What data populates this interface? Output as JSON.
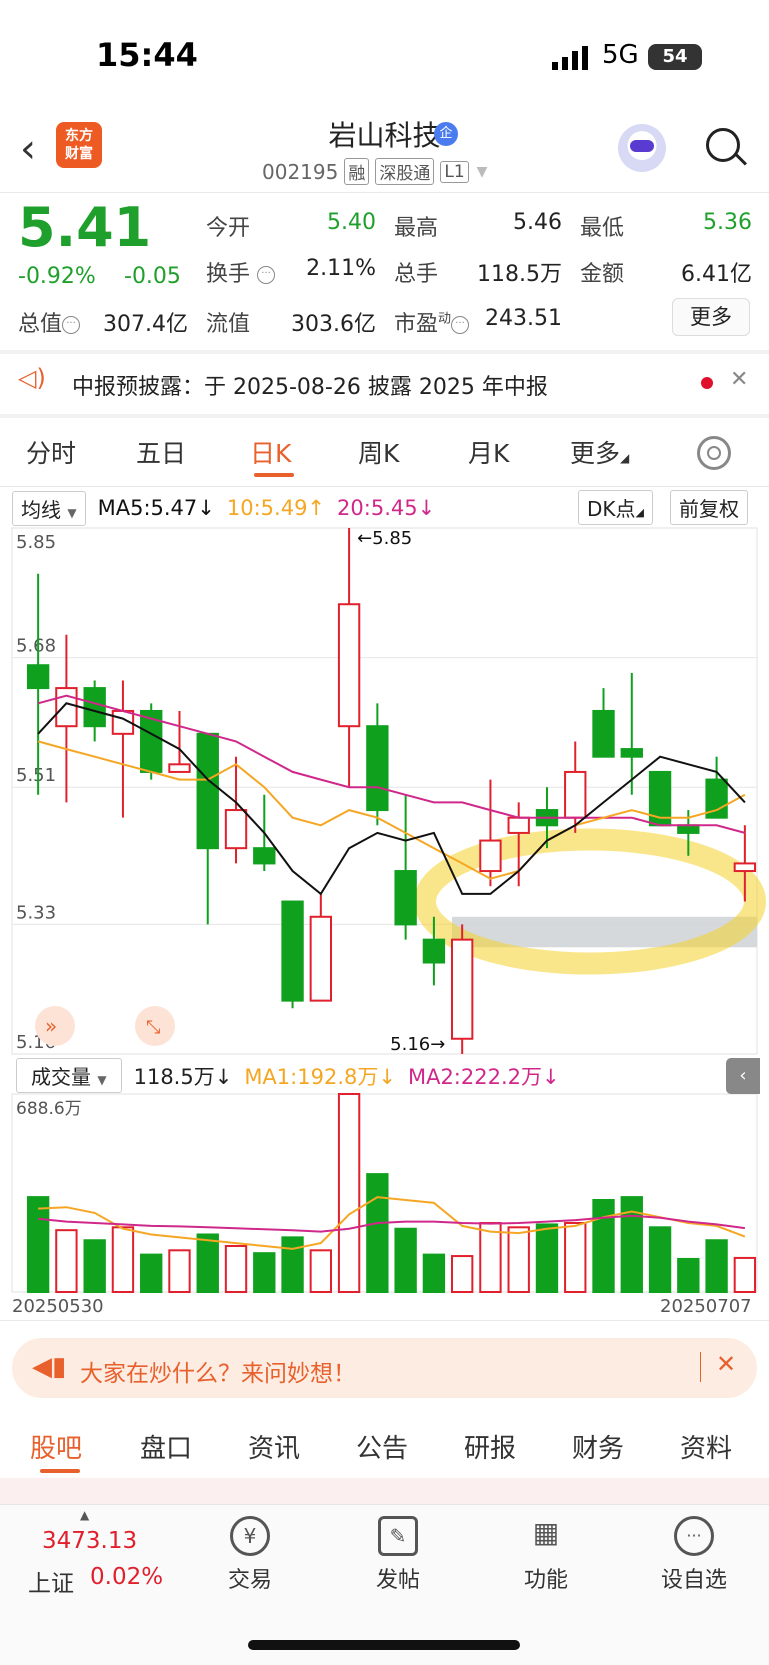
{
  "status": {
    "time": "15:44",
    "network": "5G",
    "battery": "54"
  },
  "header": {
    "app_logo": "东方\n财富",
    "stock_name": "岩山科技",
    "qi_badge": "企",
    "code": "002195",
    "tags": [
      "融",
      "深股通",
      "L1"
    ]
  },
  "quote": {
    "price": "5.41",
    "change_pct": "-0.92%",
    "change_abs": "-0.05",
    "fields": [
      {
        "label": "今开",
        "value": "5.40"
      },
      {
        "label": "最高",
        "value": "5.46"
      },
      {
        "label": "最低",
        "value": "5.36"
      },
      {
        "label": "换手",
        "value": "2.11%"
      },
      {
        "label": "总手",
        "value": "118.5万"
      },
      {
        "label": "金额",
        "value": "6.41亿"
      },
      {
        "label": "总值",
        "value": "307.4亿"
      },
      {
        "label": "流值",
        "value": "303.6亿"
      },
      {
        "label": "市盈",
        "label_sup": "动",
        "value": "243.51"
      }
    ],
    "more_button": "更多"
  },
  "notice": {
    "text": "中报预披露：于 2025-08-26 披露 2025 年中报"
  },
  "tabs": [
    "分时",
    "五日",
    "日K",
    "周K",
    "月K",
    "更多"
  ],
  "active_tab": "日K",
  "ma_bar": {
    "selector": "均线",
    "ma5": "MA5:5.47↓",
    "ma10": "10:5.49↑",
    "ma20": "20:5.45↓",
    "dk_button": "DK点",
    "fq_button": "前复权"
  },
  "volume_bar": {
    "selector": "成交量",
    "current": "118.5万↓",
    "ma1": "MA1:192.8万↓",
    "ma2": "MA2:222.2万↓"
  },
  "colors": {
    "up": "#e0202c",
    "down": "#0fa01e",
    "ma5": "#111111",
    "ma10": "#f5a623",
    "ma20": "#d0288a",
    "accent": "#e8602c"
  },
  "chart_data": {
    "type": "candlestick",
    "y_ticks": [
      "5.85",
      "5.68",
      "5.51",
      "5.33",
      "5.16"
    ],
    "ylim": [
      5.16,
      5.85
    ],
    "annotations": {
      "high": "←5.85",
      "low": "5.16→"
    },
    "candles": [
      {
        "o": 5.67,
        "c": 5.64,
        "h": 5.79,
        "l": 5.5
      },
      {
        "o": 5.59,
        "c": 5.64,
        "h": 5.71,
        "l": 5.49
      },
      {
        "o": 5.64,
        "c": 5.59,
        "h": 5.65,
        "l": 5.57
      },
      {
        "o": 5.58,
        "c": 5.61,
        "h": 5.65,
        "l": 5.47
      },
      {
        "o": 5.61,
        "c": 5.53,
        "h": 5.62,
        "l": 5.52
      },
      {
        "o": 5.53,
        "c": 5.54,
        "h": 5.61,
        "l": 5.53
      },
      {
        "o": 5.58,
        "c": 5.43,
        "h": 5.58,
        "l": 5.33
      },
      {
        "o": 5.43,
        "c": 5.48,
        "h": 5.55,
        "l": 5.41
      },
      {
        "o": 5.43,
        "c": 5.41,
        "h": 5.5,
        "l": 5.4
      },
      {
        "o": 5.36,
        "c": 5.23,
        "h": 5.36,
        "l": 5.22
      },
      {
        "o": 5.23,
        "c": 5.34,
        "h": 5.37,
        "l": 5.23
      },
      {
        "o": 5.59,
        "c": 5.75,
        "h": 5.85,
        "l": 5.51
      },
      {
        "o": 5.59,
        "c": 5.48,
        "h": 5.62,
        "l": 5.46
      },
      {
        "o": 5.4,
        "c": 5.33,
        "h": 5.5,
        "l": 5.31
      },
      {
        "o": 5.31,
        "c": 5.28,
        "h": 5.34,
        "l": 5.25
      },
      {
        "o": 5.18,
        "c": 5.31,
        "h": 5.33,
        "l": 5.16
      },
      {
        "o": 5.4,
        "c": 5.44,
        "h": 5.52,
        "l": 5.38
      },
      {
        "o": 5.45,
        "c": 5.47,
        "h": 5.49,
        "l": 5.38
      },
      {
        "o": 5.48,
        "c": 5.46,
        "h": 5.51,
        "l": 5.43
      },
      {
        "o": 5.47,
        "c": 5.53,
        "h": 5.57,
        "l": 5.45
      },
      {
        "o": 5.61,
        "c": 5.55,
        "h": 5.64,
        "l": 5.55
      },
      {
        "o": 5.56,
        "c": 5.55,
        "h": 5.66,
        "l": 5.5
      },
      {
        "o": 5.53,
        "c": 5.46,
        "h": 5.53,
        "l": 5.46
      },
      {
        "o": 5.46,
        "c": 5.45,
        "h": 5.48,
        "l": 5.42
      },
      {
        "o": 5.52,
        "c": 5.47,
        "h": 5.55,
        "l": 5.47
      },
      {
        "o": 5.4,
        "c": 5.41,
        "h": 5.46,
        "l": 5.36
      }
    ],
    "ma5": [
      5.58,
      5.62,
      5.61,
      5.6,
      5.58,
      5.56,
      5.52,
      5.49,
      5.45,
      5.4,
      5.37,
      5.43,
      5.45,
      5.44,
      5.45,
      5.37,
      5.37,
      5.4,
      5.44,
      5.46,
      5.49,
      5.52,
      5.55,
      5.54,
      5.53,
      5.49
    ],
    "ma10": [
      5.57,
      5.56,
      5.55,
      5.54,
      5.53,
      5.52,
      5.52,
      5.54,
      5.51,
      5.47,
      5.46,
      5.48,
      5.47,
      5.45,
      5.43,
      5.41,
      5.39,
      5.4,
      5.44,
      5.46,
      5.47,
      5.48,
      5.47,
      5.47,
      5.48,
      5.5
    ],
    "ma20": [
      5.62,
      5.63,
      5.62,
      5.61,
      5.6,
      5.59,
      5.58,
      5.57,
      5.55,
      5.53,
      5.52,
      5.51,
      5.51,
      5.5,
      5.49,
      5.49,
      5.48,
      5.47,
      5.47,
      5.47,
      5.47,
      5.47,
      5.46,
      5.46,
      5.46,
      5.45
    ],
    "volume_max_label": "688.6万",
    "volume_max": 688.6,
    "volumes": [
      330,
      215,
      180,
      225,
      130,
      145,
      200,
      160,
      135,
      190,
      145,
      688.6,
      410,
      220,
      130,
      125,
      240,
      225,
      235,
      240,
      320,
      330,
      225,
      115,
      180,
      118.5
    ],
    "vol_ma1": [
      290,
      295,
      275,
      220,
      200,
      190,
      180,
      170,
      160,
      150,
      170,
      270,
      330,
      320,
      310,
      230,
      210,
      205,
      220,
      230,
      260,
      280,
      260,
      240,
      230,
      192.8
    ],
    "vol_ma2": [
      255,
      245,
      240,
      235,
      230,
      228,
      225,
      222,
      218,
      215,
      210,
      220,
      240,
      245,
      245,
      240,
      238,
      240,
      245,
      250,
      258,
      265,
      258,
      245,
      235,
      222.2
    ],
    "date_start": "20250530",
    "date_end": "20250707"
  },
  "ask_banner": {
    "text": "大家在炒什么？来问妙想！"
  },
  "bottom_tabs": [
    "股吧",
    "盘口",
    "资讯",
    "公告",
    "研报",
    "财务",
    "资料"
  ],
  "footer": {
    "index_value": "3473.13",
    "index_name": "上证",
    "index_pct": "0.02%",
    "buttons": [
      {
        "label": "交易",
        "icon": "¥"
      },
      {
        "label": "发帖",
        "icon": "✎"
      },
      {
        "label": "功能",
        "icon": "▦"
      },
      {
        "label": "设自选",
        "icon": "···"
      }
    ]
  }
}
